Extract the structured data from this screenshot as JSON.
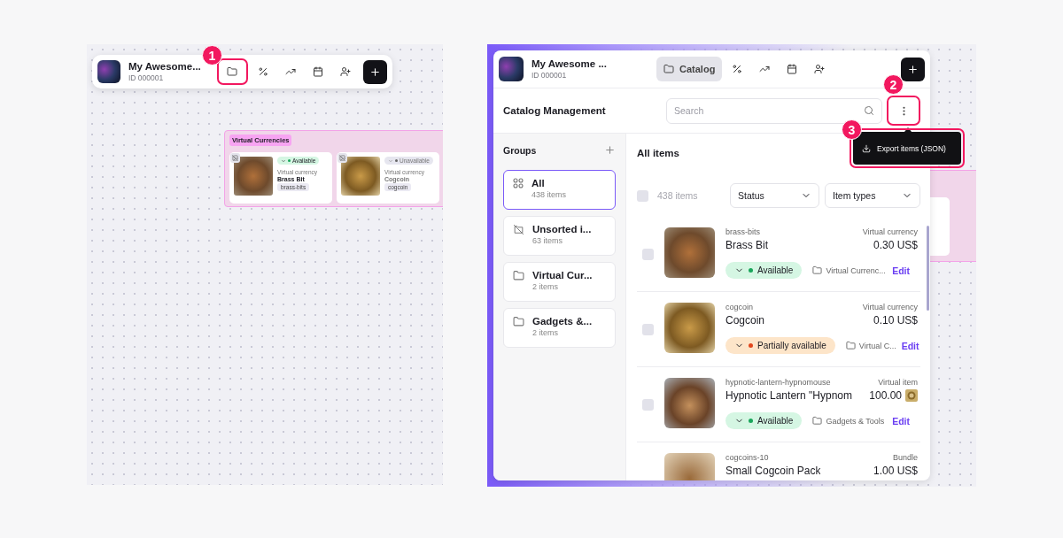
{
  "canvas_view": {
    "project": {
      "title": "My Awesome...",
      "id": "ID 000001"
    },
    "group": {
      "label": "Virtual Currencies",
      "cards": [
        {
          "status": {
            "label": "Available",
            "kind": "available"
          },
          "type": "Virtual currency",
          "name": "Brass Bit",
          "sku": "brass-bits"
        },
        {
          "status": {
            "label": "Unavailable",
            "kind": "unavailable"
          },
          "type": "Virtual currency",
          "name": "Cogcoin",
          "sku": "cogcoin"
        }
      ]
    }
  },
  "callouts": [
    "1",
    "2",
    "3"
  ],
  "app": {
    "project": {
      "title": "My Awesome ...",
      "id": "ID 000001"
    },
    "tabs": [
      {
        "label": "Catalog",
        "selected": true
      }
    ],
    "page_title": "Catalog Management",
    "search": {
      "placeholder": "Search"
    },
    "menu": [
      {
        "label": "Export items (JSON)"
      }
    ],
    "groups_title": "Groups",
    "groups": [
      {
        "kind": "all",
        "name": "All",
        "count": "438 items",
        "selected": true
      },
      {
        "kind": "unsorted",
        "name": "Unsorted i...",
        "count": "63 items",
        "selected": false
      },
      {
        "kind": "folder",
        "name": "Virtual Cur...",
        "count": "2 items",
        "selected": false
      },
      {
        "kind": "folder",
        "name": "Gadgets &...",
        "count": "2 items",
        "selected": false
      }
    ],
    "list_title": "All items",
    "select_all": {
      "label": "438 items",
      "checked": false
    },
    "filters": [
      "Status",
      "Item types"
    ],
    "items": [
      {
        "sku": "brass-bits",
        "type": "Virtual currency",
        "name": "Brass Bit",
        "price": "0.30 US$",
        "coin_price": false,
        "status": {
          "label": "Available",
          "kind": "available"
        },
        "group": "Virtual Currenc...",
        "action": "Edit",
        "checked": false
      },
      {
        "sku": "cogcoin",
        "type": "Virtual currency",
        "name": "Cogcoin",
        "price": "0.10 US$",
        "coin_price": false,
        "status": {
          "label": "Partially available",
          "kind": "partial"
        },
        "group": "Virtual C...",
        "action": "Edit",
        "checked": false
      },
      {
        "sku": "hypnotic-lantern-hypnomouse",
        "type": "Virtual item",
        "name": "Hypnotic Lantern \"Hypnom",
        "price": "100.00",
        "coin_price": true,
        "status": {
          "label": "Available",
          "kind": "available"
        },
        "group": "Gadgets & Tools",
        "action": "Edit",
        "checked": false
      },
      {
        "sku": "cogcoins-10",
        "type": "Bundle",
        "name": "Small Cogcoin Pack",
        "price": "1.00 US$",
        "coin_price": false
      }
    ]
  }
}
